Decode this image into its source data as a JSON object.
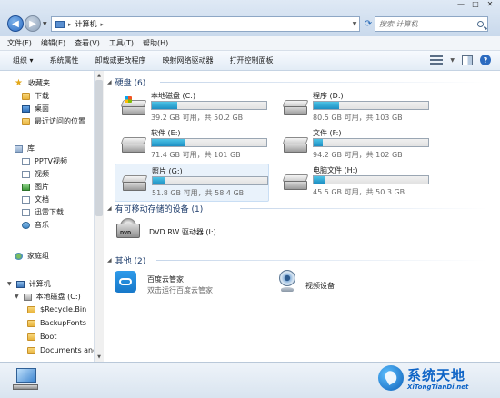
{
  "address": {
    "path": "计算机",
    "search_placeholder": "搜索 计算机"
  },
  "menu": [
    "文件(F)",
    "编辑(E)",
    "查看(V)",
    "工具(T)",
    "帮助(H)"
  ],
  "toolbar": [
    "组织 ▾",
    "系统属性",
    "卸载或更改程序",
    "映射网络驱动器",
    "打开控制面板"
  ],
  "sidebar": {
    "favorites": {
      "label": "收藏夹",
      "items": [
        "下载",
        "桌面",
        "最近访问的位置"
      ]
    },
    "libraries": {
      "label": "库",
      "items": [
        "PPTV视频",
        "视频",
        "图片",
        "文档",
        "迅雷下载",
        "音乐"
      ]
    },
    "homegroup": "家庭组",
    "computer": {
      "label": "计算机",
      "items": [
        "本地磁盘 (C:)",
        "$Recycle.Bin",
        "BackupFonts",
        "Boot",
        "Documents and"
      ]
    }
  },
  "groups": {
    "hdd": "硬盘 (6)",
    "removable": "有可移动存储的设备 (1)",
    "other": "其他 (2)"
  },
  "drives": [
    {
      "name": "本地磁盘 (C:)",
      "info": "39.2 GB 可用，共 50.2 GB",
      "used_fraction": 0.22
    },
    {
      "name": "程序 (D:)",
      "info": "80.5 GB 可用，共 103 GB",
      "used_fraction": 0.22
    },
    {
      "name": "软件 (E:)",
      "info": "71.4 GB 可用，共 101 GB",
      "used_fraction": 0.29
    },
    {
      "name": "文件 (F:)",
      "info": "94.2 GB 可用，共 102 GB",
      "used_fraction": 0.08
    },
    {
      "name": "照片 (G:)",
      "info": "51.8 GB 可用，共 58.4 GB",
      "used_fraction": 0.11
    },
    {
      "name": "电脑文件 (H:)",
      "info": "45.5 GB 可用，共 50.3 GB",
      "used_fraction": 0.1
    }
  ],
  "removable": {
    "name": "DVD RW 驱动器 (I:)",
    "icon_text": "DVD"
  },
  "other_items": [
    {
      "name": "百度云管家",
      "sub": "双击运行百度云管家"
    },
    {
      "name": "视频设备",
      "sub": ""
    }
  ],
  "watermark": {
    "title": "系统天地",
    "sub": "XiTongTianDi.net"
  }
}
